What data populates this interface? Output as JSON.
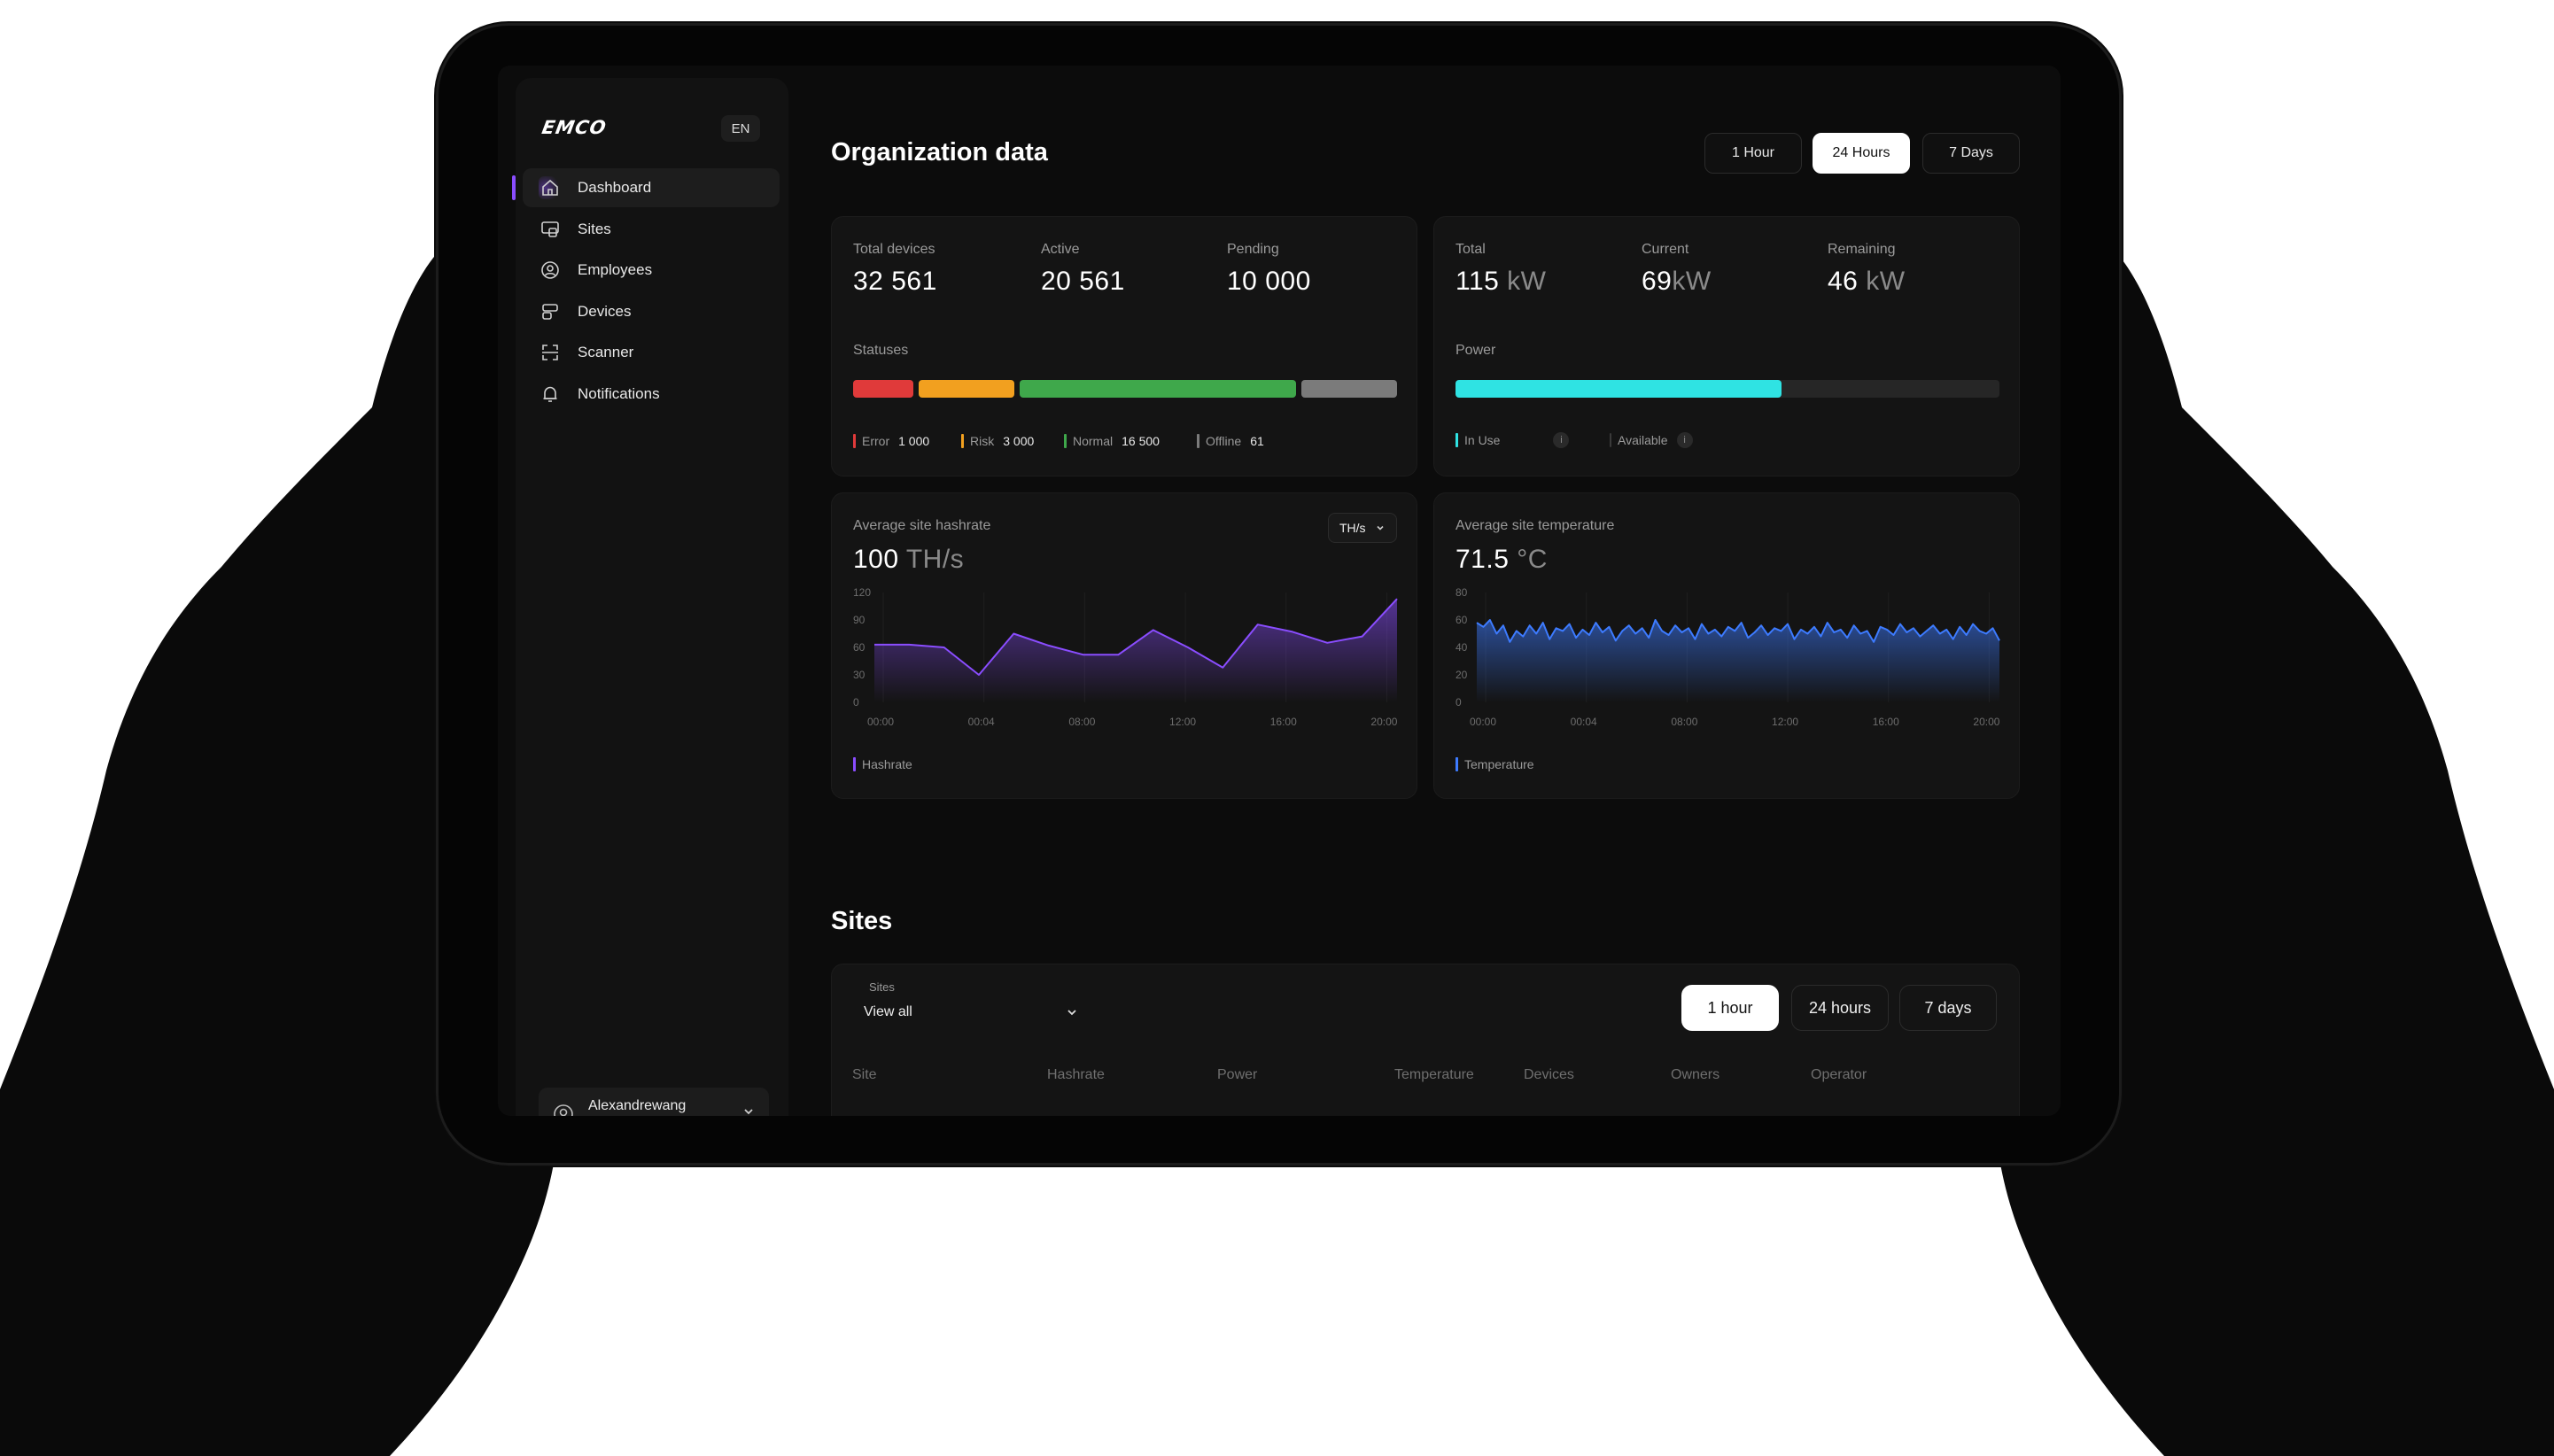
{
  "sidebar": {
    "logo": "EMCO",
    "language": "EN",
    "items": [
      {
        "label": "Dashboard",
        "icon": "home-icon",
        "active": true
      },
      {
        "label": "Sites",
        "icon": "sites-icon",
        "active": false
      },
      {
        "label": "Employees",
        "icon": "employees-icon",
        "active": false
      },
      {
        "label": "Devices",
        "icon": "devices-icon",
        "active": false
      },
      {
        "label": "Scanner",
        "icon": "scanner-icon",
        "active": false
      },
      {
        "label": "Notifications",
        "icon": "bell-icon",
        "active": false
      }
    ],
    "user": {
      "name": "Alexandrewang"
    }
  },
  "header": {
    "title": "Organization data",
    "ranges": [
      {
        "label": "1 Hour",
        "selected": false
      },
      {
        "label": "24 Hours",
        "selected": true
      },
      {
        "label": "7 Days",
        "selected": false
      }
    ]
  },
  "devices": {
    "total_label": "Total devices",
    "total": "32 561",
    "active_label": "Active",
    "active": "20 561",
    "pending_label": "Pending",
    "pending": "10 000",
    "statuses_label": "Statuses",
    "statuses": [
      {
        "label": "Error",
        "value": "1 000",
        "color": "#e03a3a"
      },
      {
        "label": "Risk",
        "value": "3 000",
        "color": "#f2a01f"
      },
      {
        "label": "Normal",
        "value": "16 500",
        "color": "#3fa84b"
      },
      {
        "label": "Offline",
        "value": "61",
        "color": "#7b7b7b"
      }
    ]
  },
  "power": {
    "total_label": "Total",
    "total": "115",
    "total_unit": "kW",
    "current_label": "Current",
    "current": "69",
    "current_unit": "kW",
    "remaining_label": "Remaining",
    "remaining": "46",
    "remaining_unit": "kW",
    "power_label": "Power",
    "in_use_label": "In Use",
    "available_label": "Available",
    "in_use_fraction": 0.6,
    "in_use_color": "#2fe3e3"
  },
  "hashrate": {
    "label": "Average site hashrate",
    "value": "100",
    "unit": "TH/s",
    "unit_select": "TH/s",
    "legend": "Hashrate",
    "color": "#8a4dff"
  },
  "temperature": {
    "label": "Average site temperature",
    "value": "71.5",
    "unit": "°C",
    "legend": "Temperature",
    "color": "#3d7bff"
  },
  "chart_data": [
    {
      "type": "area",
      "title": "Average site hashrate",
      "x_ticks": [
        "00:00",
        "00:04",
        "08:00",
        "12:00",
        "16:00",
        "20:00"
      ],
      "y_ticks": [
        "120",
        "90",
        "60",
        "30",
        "0"
      ],
      "ylim": [
        0,
        120
      ],
      "series": [
        {
          "name": "Hashrate",
          "values": [
            63,
            63,
            60,
            30,
            75,
            62,
            52,
            52,
            79,
            60,
            38,
            85,
            77,
            65,
            72,
            113
          ]
        }
      ]
    },
    {
      "type": "area",
      "title": "Average site temperature",
      "x_ticks": [
        "00:00",
        "00:04",
        "08:00",
        "12:00",
        "16:00",
        "20:00"
      ],
      "y_ticks": [
        "80",
        "60",
        "40",
        "20",
        "0"
      ],
      "ylim": [
        0,
        80
      ],
      "series": [
        {
          "name": "Temperature",
          "values": [
            58,
            55,
            60,
            50,
            56,
            44,
            52,
            48,
            56,
            50,
            58,
            46,
            54,
            52,
            57,
            47,
            53,
            49,
            58,
            51,
            55,
            45,
            52,
            56,
            50,
            54,
            47,
            60,
            52,
            49,
            56,
            51,
            54,
            46,
            57,
            50,
            53,
            48,
            55,
            52,
            58,
            47,
            51,
            56,
            49,
            54,
            52,
            57,
            46,
            53,
            50,
            55,
            48,
            58,
            51,
            53,
            47,
            56,
            50,
            52,
            44,
            55,
            53,
            49,
            57,
            51,
            54,
            48,
            52,
            56,
            50,
            53,
            46,
            55,
            49,
            57,
            52,
            50,
            54,
            45
          ]
        }
      ]
    }
  ],
  "sites": {
    "title": "Sites",
    "filter_label": "Sites",
    "filter_value": "View all",
    "ranges": [
      {
        "label": "1 hour",
        "selected": true
      },
      {
        "label": "24 hours",
        "selected": false
      },
      {
        "label": "7 days",
        "selected": false
      }
    ],
    "columns": [
      "Site",
      "Hashrate",
      "Power",
      "Temperature",
      "Devices",
      "Owners",
      "Operator"
    ]
  }
}
